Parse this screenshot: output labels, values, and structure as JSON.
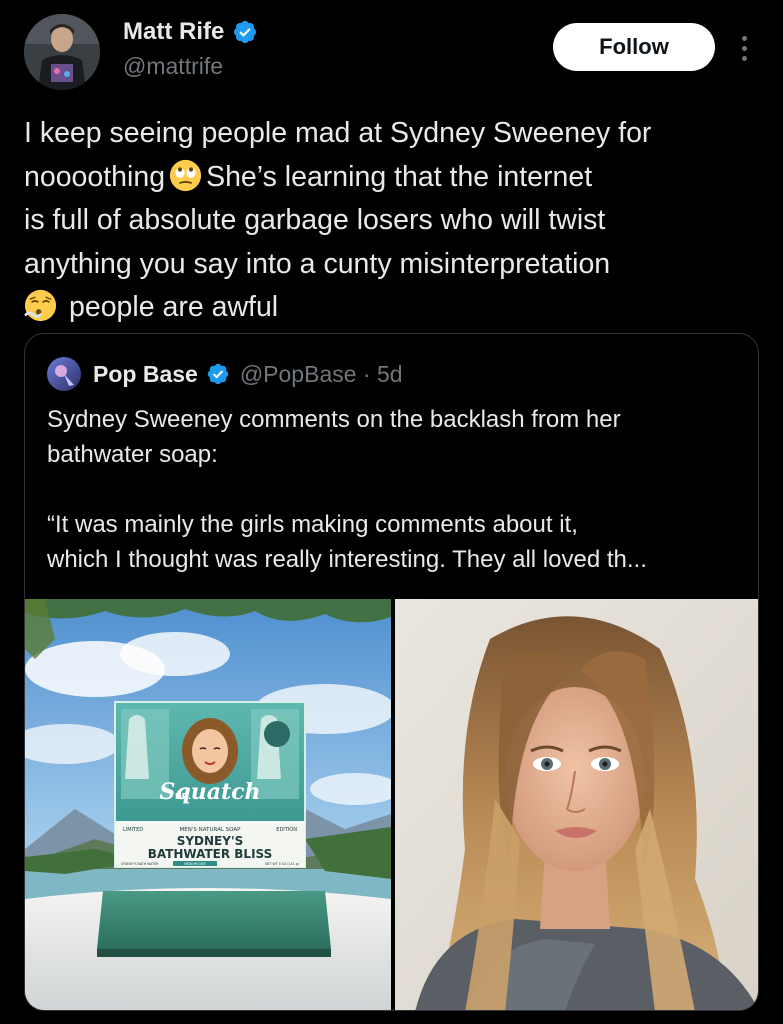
{
  "tweet": {
    "author": {
      "name": "Matt Rife",
      "handle": "@mattrife",
      "verified": true
    },
    "follow_label": "Follow",
    "text_lines": [
      "I keep seeing people mad at Sydney Sweeney for",
      "noooothing",
      "She’s learning that the internet",
      "is full of absolute garbage losers who will twist",
      "anything you say into a cunty misinterpretation",
      "people are awful"
    ],
    "emojis": [
      "face-with-rolling-eyes-emoji",
      "face-exhaling-emoji"
    ]
  },
  "quoted": {
    "name": "Pop Base",
    "handle_time": "@PopBase · 5d",
    "verified": true,
    "text_lines": [
      "Sydney Sweeney comments on the backlash from her",
      "bathwater soap:",
      "",
      "“It was mainly the girls making comments about it,",
      "which I thought was really interesting. They all loved th..."
    ],
    "soap_box": {
      "brand": "Squatch",
      "brand_prefix": "DR.",
      "tagline_left": "LIMITED",
      "tagline_mid": "MEN'S NATURAL SOAP",
      "tagline_right": "EDITION",
      "product_line1": "SYDNEY'S",
      "product_line2": "BATHWATER BLISS",
      "fineprint_left": "SYDNEY'S BATH WATER",
      "fineprint_mid": "MEDIUM GRIT",
      "fineprint_right": "NET WT 5 OZ (141 g)"
    }
  },
  "colors": {
    "background": "#000000",
    "text": "#e7e9ea",
    "muted": "#71767b",
    "border": "#2f3336",
    "verified": "#1d9bf0"
  }
}
